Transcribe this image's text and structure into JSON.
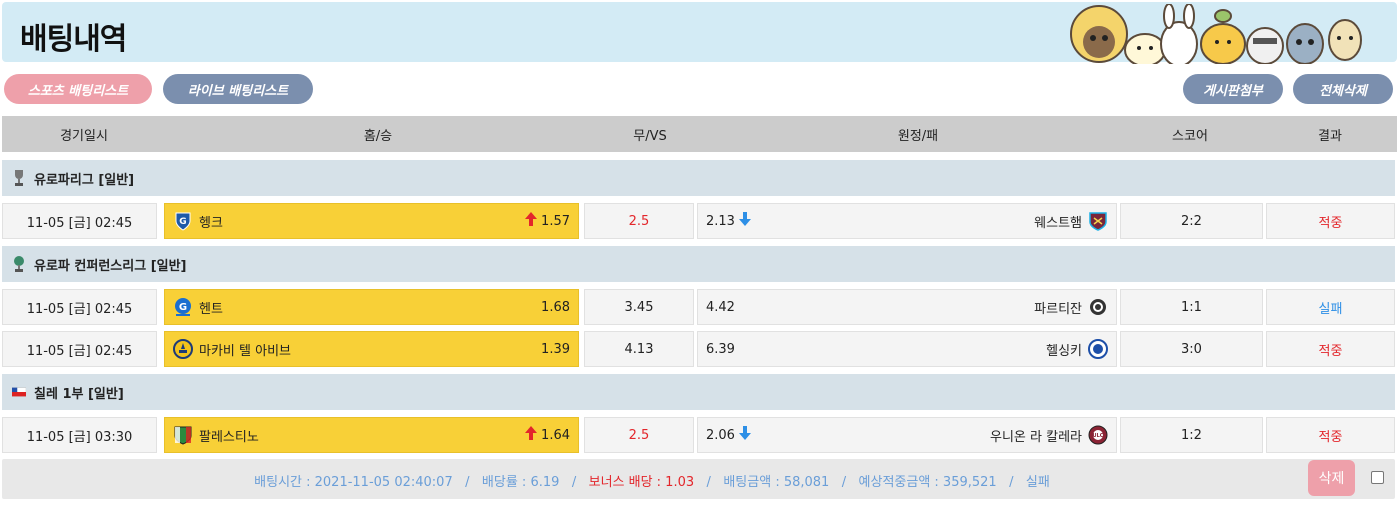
{
  "header": {
    "title": "배팅내역"
  },
  "buttons": {
    "sports_list": "스포츠 배팅리스트",
    "live_list": "라이브 배팅리스트",
    "board_attach": "게시판첨부",
    "delete_all": "전체삭제"
  },
  "columns": {
    "date": "경기일시",
    "home": "홈/승",
    "draw": "무/VS",
    "away": "원정/패",
    "score": "스코어",
    "result": "결과"
  },
  "leagues": [
    {
      "name": "유로파리그 [일반]",
      "matches": [
        {
          "date": "11-05 [금] 02:45",
          "home": "헹크",
          "home_odds": "1.57",
          "home_trend": "up",
          "draw": "2.5",
          "draw_red": true,
          "away_odds": "2.13",
          "away_trend": "down",
          "away": "웨스트햄",
          "score": "2:2",
          "result": "적중",
          "result_type": "hit"
        }
      ]
    },
    {
      "name": "유로파 컨퍼런스리그 [일반]",
      "matches": [
        {
          "date": "11-05 [금] 02:45",
          "home": "헨트",
          "home_odds": "1.68",
          "home_trend": "",
          "draw": "3.45",
          "draw_red": false,
          "away_odds": "4.42",
          "away_trend": "",
          "away": "파르티잔",
          "score": "1:1",
          "result": "실패",
          "result_type": "fail"
        },
        {
          "date": "11-05 [금] 02:45",
          "home": "마카비 텔 아비브",
          "home_odds": "1.39",
          "home_trend": "",
          "draw": "4.13",
          "draw_red": false,
          "away_odds": "6.39",
          "away_trend": "",
          "away": "헬싱키",
          "score": "3:0",
          "result": "적중",
          "result_type": "hit"
        }
      ]
    },
    {
      "name": "칠레 1부 [일반]",
      "matches": [
        {
          "date": "11-05 [금] 03:30",
          "home": "팔레스티노",
          "home_odds": "1.64",
          "home_trend": "up",
          "draw": "2.5",
          "draw_red": true,
          "away_odds": "2.06",
          "away_trend": "down",
          "away": "우니온 라 칼레라",
          "score": "1:2",
          "result": "적중",
          "result_type": "hit"
        }
      ]
    }
  ],
  "footer": {
    "bet_time": "배팅시간 : 2021-11-05 02:40:07",
    "sep": "/",
    "odds": "배당률 : 6.19",
    "bonus": "보너스 배당 : 1.03",
    "bet_amount": "배팅금액 : 58,081",
    "expected": "예상적중금액 : 359,521",
    "status": "실패",
    "delete_label": "삭제"
  },
  "colors": {
    "hit": "#e3262b",
    "fail": "#2d8fe6",
    "home_bg": "#f8d037",
    "header_bg": "#d3ebf5"
  },
  "icons": {
    "up": "arrow-up-icon",
    "down": "arrow-down-icon"
  }
}
